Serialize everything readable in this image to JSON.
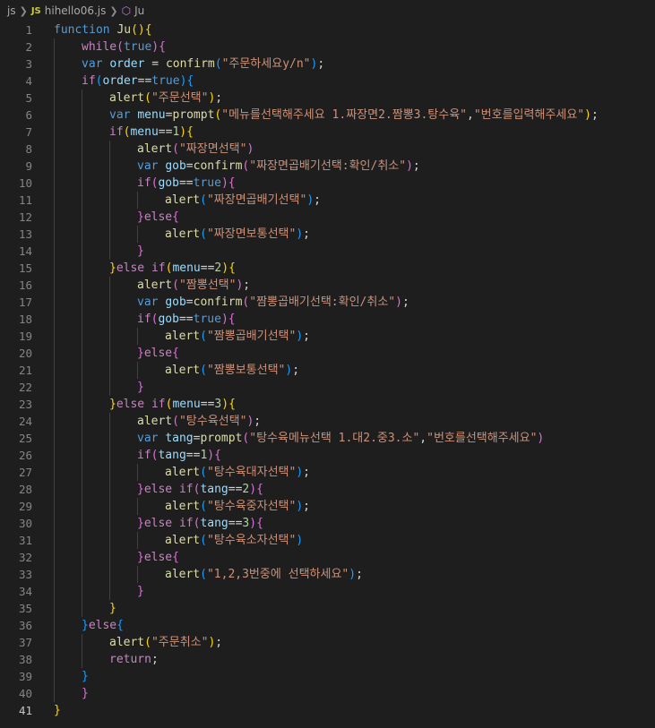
{
  "breadcrumb": {
    "folder": "js",
    "file_badge": "JS",
    "file": "hihello06.js",
    "symbol": "Ju"
  },
  "editor": {
    "current_line": 41,
    "lines": [
      {
        "n": "1",
        "indent": 0,
        "tokens": [
          [
            "function ",
            "kw"
          ],
          [
            "Ju",
            "fn"
          ],
          [
            "()",
            "p1"
          ],
          [
            "{",
            "p1"
          ]
        ]
      },
      {
        "n": "2",
        "indent": 1,
        "tokens": [
          [
            "while",
            "ctl"
          ],
          [
            "(",
            "p2"
          ],
          [
            "true",
            "kw"
          ],
          [
            ")",
            "p2"
          ],
          [
            "{",
            "p2"
          ]
        ]
      },
      {
        "n": "3",
        "indent": 1,
        "tokens": [
          [
            "var ",
            "kw"
          ],
          [
            "order",
            "var"
          ],
          [
            " = ",
            "def"
          ],
          [
            "confirm",
            "fn"
          ],
          [
            "(",
            "p3"
          ],
          [
            "\"주문하세요y/n\"",
            "str"
          ],
          [
            ")",
            "p3"
          ],
          [
            ";",
            "def"
          ]
        ]
      },
      {
        "n": "4",
        "indent": 1,
        "tokens": [
          [
            "if",
            "ctl"
          ],
          [
            "(",
            "p3"
          ],
          [
            "order",
            "var"
          ],
          [
            "==",
            "def"
          ],
          [
            "true",
            "kw"
          ],
          [
            ")",
            "p3"
          ],
          [
            "{",
            "p3"
          ]
        ]
      },
      {
        "n": "5",
        "indent": 2,
        "tokens": [
          [
            "alert",
            "fn"
          ],
          [
            "(",
            "p1"
          ],
          [
            "\"주문선택\"",
            "str"
          ],
          [
            ")",
            "p1"
          ],
          [
            ";",
            "def"
          ]
        ]
      },
      {
        "n": "6",
        "indent": 2,
        "tokens": [
          [
            "var ",
            "kw"
          ],
          [
            "menu",
            "var"
          ],
          [
            "=",
            "def"
          ],
          [
            "prompt",
            "fn"
          ],
          [
            "(",
            "p1"
          ],
          [
            "\"메뉴를선택해주세요 1.짜장면2.짬뽕3.탕수육\"",
            "str"
          ],
          [
            ",",
            "def"
          ],
          [
            "\"번호를입력해주세요\"",
            "str"
          ],
          [
            ")",
            "p1"
          ],
          [
            ";",
            "def"
          ]
        ]
      },
      {
        "n": "7",
        "indent": 2,
        "tokens": [
          [
            "if",
            "ctl"
          ],
          [
            "(",
            "p1"
          ],
          [
            "menu",
            "var"
          ],
          [
            "==",
            "def"
          ],
          [
            "1",
            "num"
          ],
          [
            ")",
            "p1"
          ],
          [
            "{",
            "p1"
          ]
        ]
      },
      {
        "n": "8",
        "indent": 3,
        "tokens": [
          [
            "alert",
            "fn"
          ],
          [
            "(",
            "p2"
          ],
          [
            "\"짜장면선택\"",
            "str"
          ],
          [
            ")",
            "p2"
          ]
        ]
      },
      {
        "n": "9",
        "indent": 3,
        "tokens": [
          [
            "var ",
            "kw"
          ],
          [
            "gob",
            "var"
          ],
          [
            "=",
            "def"
          ],
          [
            "confirm",
            "fn"
          ],
          [
            "(",
            "p2"
          ],
          [
            "\"짜장면곱배기선택:확인/취소\"",
            "str"
          ],
          [
            ")",
            "p2"
          ],
          [
            ";",
            "def"
          ]
        ]
      },
      {
        "n": "10",
        "indent": 3,
        "tokens": [
          [
            "if",
            "ctl"
          ],
          [
            "(",
            "p2"
          ],
          [
            "gob",
            "var"
          ],
          [
            "==",
            "def"
          ],
          [
            "true",
            "kw"
          ],
          [
            ")",
            "p2"
          ],
          [
            "{",
            "p2"
          ]
        ]
      },
      {
        "n": "11",
        "indent": 4,
        "tokens": [
          [
            "alert",
            "fn"
          ],
          [
            "(",
            "p3"
          ],
          [
            "\"짜장면곱배기선택\"",
            "str"
          ],
          [
            ")",
            "p3"
          ],
          [
            ";",
            "def"
          ]
        ]
      },
      {
        "n": "12",
        "indent": 3,
        "tokens": [
          [
            "}",
            "p2"
          ],
          [
            "else",
            "ctl"
          ],
          [
            "{",
            "p2"
          ]
        ]
      },
      {
        "n": "13",
        "indent": 4,
        "tokens": [
          [
            "alert",
            "fn"
          ],
          [
            "(",
            "p3"
          ],
          [
            "\"짜장면보통선택\"",
            "str"
          ],
          [
            ")",
            "p3"
          ],
          [
            ";",
            "def"
          ]
        ]
      },
      {
        "n": "14",
        "indent": 3,
        "tokens": [
          [
            "}",
            "p2"
          ]
        ]
      },
      {
        "n": "15",
        "indent": 2,
        "tokens": [
          [
            "}",
            "p1"
          ],
          [
            "else ",
            "ctl"
          ],
          [
            "if",
            "ctl"
          ],
          [
            "(",
            "p1"
          ],
          [
            "menu",
            "var"
          ],
          [
            "==",
            "def"
          ],
          [
            "2",
            "num"
          ],
          [
            ")",
            "p1"
          ],
          [
            "{",
            "p1"
          ]
        ]
      },
      {
        "n": "16",
        "indent": 3,
        "tokens": [
          [
            "alert",
            "fn"
          ],
          [
            "(",
            "p2"
          ],
          [
            "\"짬뽕선택\"",
            "str"
          ],
          [
            ")",
            "p2"
          ],
          [
            ";",
            "def"
          ]
        ]
      },
      {
        "n": "17",
        "indent": 3,
        "tokens": [
          [
            "var ",
            "kw"
          ],
          [
            "gob",
            "var"
          ],
          [
            "=",
            "def"
          ],
          [
            "confirm",
            "fn"
          ],
          [
            "(",
            "p2"
          ],
          [
            "\"짬뽕곱배기선택:확인/취소\"",
            "str"
          ],
          [
            ")",
            "p2"
          ],
          [
            ";",
            "def"
          ]
        ]
      },
      {
        "n": "18",
        "indent": 3,
        "tokens": [
          [
            "if",
            "ctl"
          ],
          [
            "(",
            "p2"
          ],
          [
            "gob",
            "var"
          ],
          [
            "==",
            "def"
          ],
          [
            "true",
            "kw"
          ],
          [
            ")",
            "p2"
          ],
          [
            "{",
            "p2"
          ]
        ]
      },
      {
        "n": "19",
        "indent": 4,
        "tokens": [
          [
            "alert",
            "fn"
          ],
          [
            "(",
            "p3"
          ],
          [
            "\"짬뽕곱배기선택\"",
            "str"
          ],
          [
            ")",
            "p3"
          ],
          [
            ";",
            "def"
          ]
        ]
      },
      {
        "n": "20",
        "indent": 3,
        "tokens": [
          [
            "}",
            "p2"
          ],
          [
            "else",
            "ctl"
          ],
          [
            "{",
            "p2"
          ]
        ]
      },
      {
        "n": "21",
        "indent": 4,
        "tokens": [
          [
            "alert",
            "fn"
          ],
          [
            "(",
            "p3"
          ],
          [
            "\"짬뽕보통선택\"",
            "str"
          ],
          [
            ")",
            "p3"
          ],
          [
            ";",
            "def"
          ]
        ]
      },
      {
        "n": "22",
        "indent": 3,
        "tokens": [
          [
            "}",
            "p2"
          ]
        ]
      },
      {
        "n": "23",
        "indent": 2,
        "tokens": [
          [
            "}",
            "p1"
          ],
          [
            "else ",
            "ctl"
          ],
          [
            "if",
            "ctl"
          ],
          [
            "(",
            "p1"
          ],
          [
            "menu",
            "var"
          ],
          [
            "==",
            "def"
          ],
          [
            "3",
            "num"
          ],
          [
            ")",
            "p1"
          ],
          [
            "{",
            "p1"
          ]
        ]
      },
      {
        "n": "24",
        "indent": 3,
        "tokens": [
          [
            "alert",
            "fn"
          ],
          [
            "(",
            "p2"
          ],
          [
            "\"탕수육선택\"",
            "str"
          ],
          [
            ")",
            "p2"
          ],
          [
            ";",
            "def"
          ]
        ]
      },
      {
        "n": "25",
        "indent": 3,
        "tokens": [
          [
            "var ",
            "kw"
          ],
          [
            "tang",
            "var"
          ],
          [
            "=",
            "def"
          ],
          [
            "prompt",
            "fn"
          ],
          [
            "(",
            "p2"
          ],
          [
            "\"탕수육메뉴선택 1.대2.중3.소\"",
            "str"
          ],
          [
            ",",
            "def"
          ],
          [
            "\"번호를선택해주세요\"",
            "str"
          ],
          [
            ")",
            "p2"
          ]
        ]
      },
      {
        "n": "26",
        "indent": 3,
        "tokens": [
          [
            "if",
            "ctl"
          ],
          [
            "(",
            "p2"
          ],
          [
            "tang",
            "var"
          ],
          [
            "==",
            "def"
          ],
          [
            "1",
            "num"
          ],
          [
            ")",
            "p2"
          ],
          [
            "{",
            "p2"
          ]
        ]
      },
      {
        "n": "27",
        "indent": 4,
        "tokens": [
          [
            "alert",
            "fn"
          ],
          [
            "(",
            "p3"
          ],
          [
            "\"탕수육대자선택\"",
            "str"
          ],
          [
            ")",
            "p3"
          ],
          [
            ";",
            "def"
          ]
        ]
      },
      {
        "n": "28",
        "indent": 3,
        "tokens": [
          [
            "}",
            "p2"
          ],
          [
            "else ",
            "ctl"
          ],
          [
            "if",
            "ctl"
          ],
          [
            "(",
            "p2"
          ],
          [
            "tang",
            "var"
          ],
          [
            "==",
            "def"
          ],
          [
            "2",
            "num"
          ],
          [
            ")",
            "p2"
          ],
          [
            "{",
            "p2"
          ]
        ]
      },
      {
        "n": "29",
        "indent": 4,
        "tokens": [
          [
            "alert",
            "fn"
          ],
          [
            "(",
            "p3"
          ],
          [
            "\"탕수육중자선택\"",
            "str"
          ],
          [
            ")",
            "p3"
          ],
          [
            ";",
            "def"
          ]
        ]
      },
      {
        "n": "30",
        "indent": 3,
        "tokens": [
          [
            "}",
            "p2"
          ],
          [
            "else ",
            "ctl"
          ],
          [
            "if",
            "ctl"
          ],
          [
            "(",
            "p2"
          ],
          [
            "tang",
            "var"
          ],
          [
            "==",
            "def"
          ],
          [
            "3",
            "num"
          ],
          [
            ")",
            "p2"
          ],
          [
            "{",
            "p2"
          ]
        ]
      },
      {
        "n": "31",
        "indent": 4,
        "tokens": [
          [
            "alert",
            "fn"
          ],
          [
            "(",
            "p3"
          ],
          [
            "\"탕수육소자선택\"",
            "str"
          ],
          [
            ")",
            "p3"
          ]
        ]
      },
      {
        "n": "32",
        "indent": 3,
        "tokens": [
          [
            "}",
            "p2"
          ],
          [
            "else",
            "ctl"
          ],
          [
            "{",
            "p2"
          ]
        ]
      },
      {
        "n": "33",
        "indent": 4,
        "tokens": [
          [
            "alert",
            "fn"
          ],
          [
            "(",
            "p3"
          ],
          [
            "\"1,2,3번중에 선택하세요\"",
            "str"
          ],
          [
            ")",
            "p3"
          ],
          [
            ";",
            "def"
          ]
        ]
      },
      {
        "n": "34",
        "indent": 3,
        "tokens": [
          [
            "}",
            "p2"
          ]
        ]
      },
      {
        "n": "35",
        "indent": 2,
        "tokens": [
          [
            "}",
            "p1"
          ]
        ]
      },
      {
        "n": "36",
        "indent": 1,
        "tokens": [
          [
            "}",
            "p3"
          ],
          [
            "else",
            "ctl"
          ],
          [
            "{",
            "p3"
          ]
        ]
      },
      {
        "n": "37",
        "indent": 2,
        "tokens": [
          [
            "alert",
            "fn"
          ],
          [
            "(",
            "p1"
          ],
          [
            "\"주문취소\"",
            "str"
          ],
          [
            ")",
            "p1"
          ],
          [
            ";",
            "def"
          ]
        ]
      },
      {
        "n": "38",
        "indent": 2,
        "tokens": [
          [
            "return",
            "ctl"
          ],
          [
            ";",
            "def"
          ]
        ]
      },
      {
        "n": "39",
        "indent": 1,
        "tokens": [
          [
            "}",
            "p3"
          ]
        ]
      },
      {
        "n": "40",
        "indent": 1,
        "tokens": [
          [
            "}",
            "p2"
          ]
        ]
      },
      {
        "n": "41",
        "indent": 0,
        "tokens": [
          [
            "}",
            "p1"
          ]
        ]
      }
    ]
  },
  "colors": {
    "background": "#1e1e1e",
    "keyword": "#569cd6",
    "control": "#c586c0",
    "function": "#dcdcaa",
    "variable": "#9cdcfe",
    "string": "#ce9178",
    "number": "#b5cea8",
    "bracket_1": "#ffd700",
    "bracket_2": "#da70d6",
    "bracket_3": "#179fff"
  }
}
